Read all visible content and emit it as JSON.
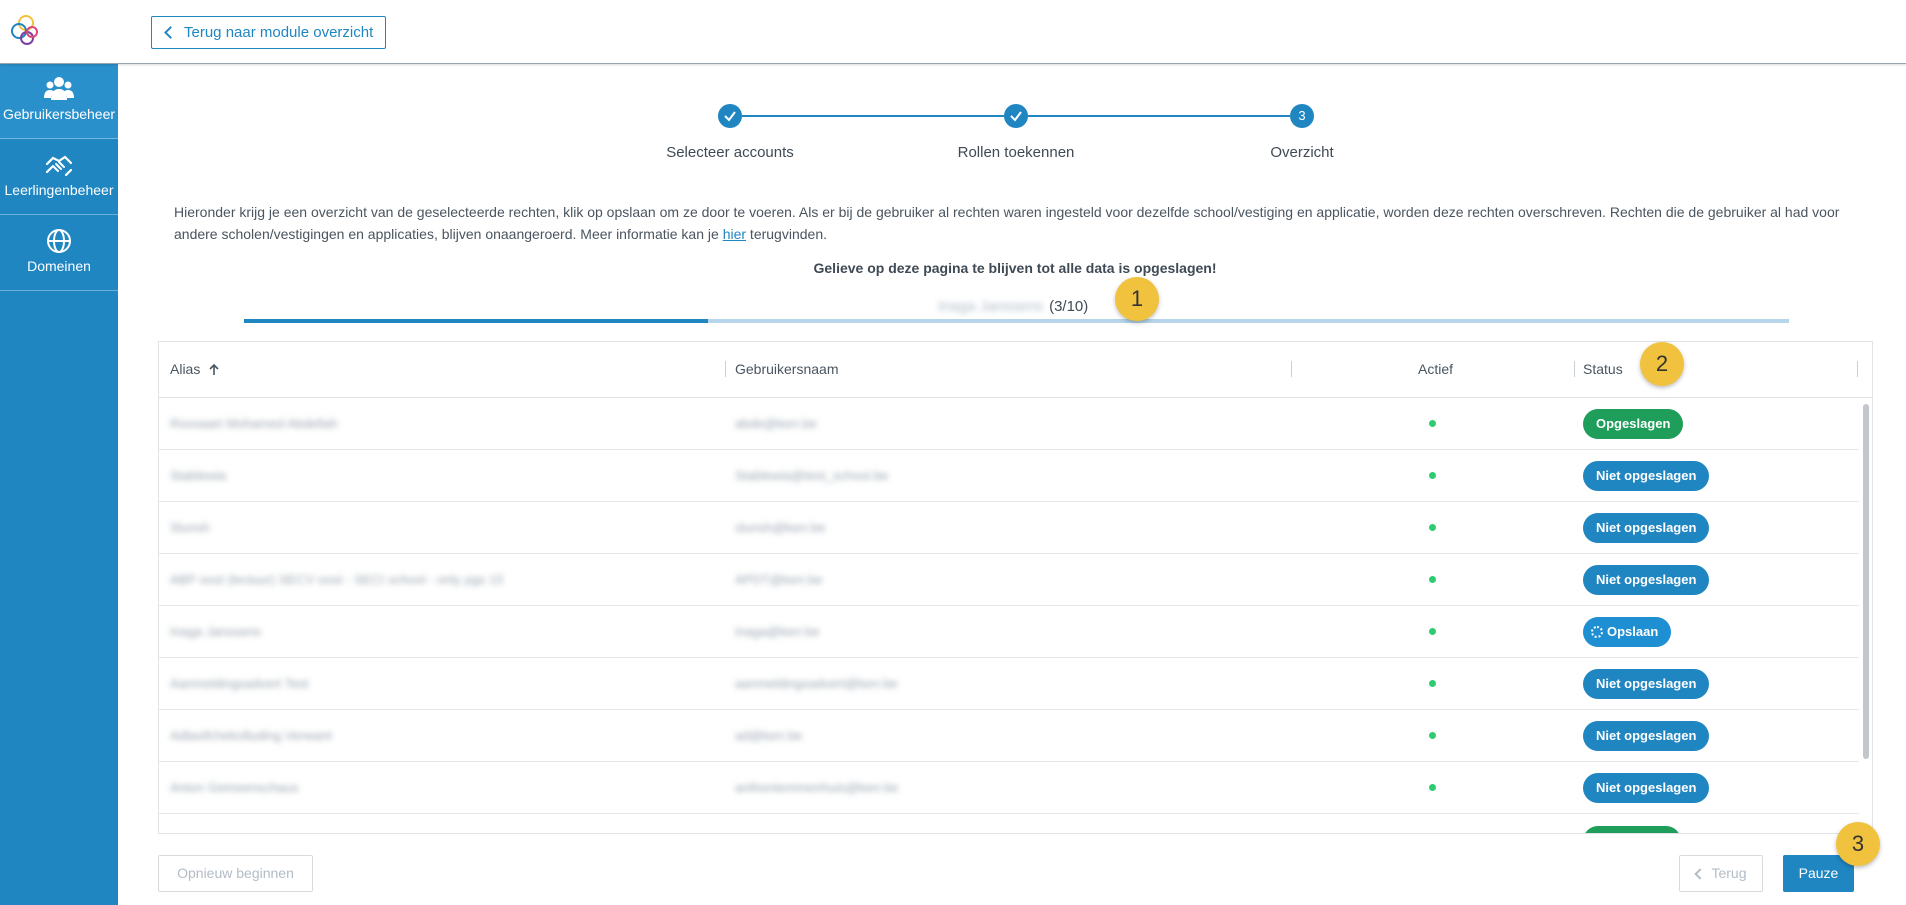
{
  "header": {
    "back_label": "Terug naar module overzicht"
  },
  "sidebar": {
    "items": [
      {
        "label": "Gebruikersbeheer",
        "icon": "users-icon"
      },
      {
        "label": "Leerlingenbeheer",
        "icon": "handshake-icon"
      },
      {
        "label": "Domeinen",
        "icon": "globe-icon"
      }
    ]
  },
  "stepper": {
    "steps": [
      {
        "label": "Selecteer accounts",
        "state": "done"
      },
      {
        "label": "Rollen toekennen",
        "state": "done"
      },
      {
        "label": "Overzicht",
        "state": "current",
        "number": "3"
      }
    ]
  },
  "intro": {
    "text_before": "Hieronder krijg je een overzicht van de geselecteerde rechten, klik op opslaan om ze door te voeren. Als er bij de gebruiker al rechten waren ingesteld voor dezelfde school/vestiging en applicatie, worden deze rechten overschreven. Rechten die de gebruiker al had voor andere scholen/vestigingen en applicaties, blijven onaangeroerd. Meer informatie kan je ",
    "link": "hier",
    "text_after": " terugvinden."
  },
  "warning": "Gelieve op deze pagina te blijven tot alle data is opgeslagen!",
  "progress": {
    "current_name": "Inaga Janssens",
    "count": "(3/10)",
    "fraction": 0.3
  },
  "table": {
    "columns": [
      "Alias",
      "Gebruikersnaam",
      "Actief",
      "Status"
    ],
    "rows": [
      {
        "alias": "Roosaart Mohamed Abdellah",
        "username": "abde@kerr.be",
        "status": "Opgeslagen",
        "type": "saved"
      },
      {
        "alias": "Stablewia",
        "username": "Stablewia@test_school.be",
        "status": "Niet opgeslagen",
        "type": "notsaved"
      },
      {
        "alias": "Slunsh",
        "username": "slunsh@kerr.be",
        "status": "Niet opgeslagen",
        "type": "notsaved"
      },
      {
        "alias": "ABP oost (lectuur) SECV oost - SECI school - only pgs 15",
        "username": "APDT@kerr.be",
        "status": "Niet opgeslagen",
        "type": "notsaved"
      },
      {
        "alias": "Inaga Janssens",
        "username": "inaga@kerr.be",
        "status": "Opslaan",
        "type": "saving"
      },
      {
        "alias": "Aanmeldingsadvert Test",
        "username": "aanmeldingsadvert@kerr.be",
        "status": "Niet opgeslagen",
        "type": "notsaved"
      },
      {
        "alias": "Adlasifchekolluding Verwant",
        "username": "ad@kerr.be",
        "status": "Niet opgeslagen",
        "type": "notsaved"
      },
      {
        "alias": "Anton Gemeenschaus",
        "username": "anthontemmenhuis@kerr.be",
        "status": "Niet opgeslagen",
        "type": "notsaved"
      }
    ]
  },
  "buttons": {
    "restart": "Opnieuw beginnen",
    "back": "Terug",
    "pause": "Pauze"
  },
  "markers": [
    "1",
    "2",
    "3"
  ]
}
